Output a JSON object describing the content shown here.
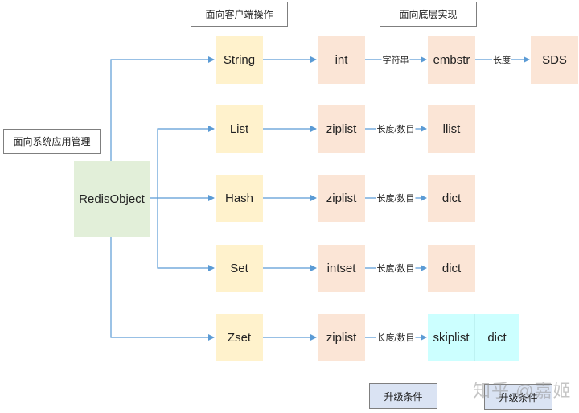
{
  "headers": {
    "client": "面向客户端操作",
    "underlying": "面向底层实现",
    "system": "面向系统应用管理"
  },
  "root": {
    "label": "RedisObject",
    "color": "#e2efd9"
  },
  "colors": {
    "type_fill": "#fff2cc",
    "encoding_fill": "#fbe5d6",
    "zset_final_fill": "#ccffff",
    "upgrade_fill": "#dae3f3",
    "arrow": "#5b9bd5"
  },
  "rows": [
    {
      "type": "String",
      "enc1": "int",
      "cond1": "字符串",
      "enc2": "embstr",
      "cond2": "长度",
      "enc3": "SDS"
    },
    {
      "type": "List",
      "enc1": "ziplist",
      "cond1": "长度/数目",
      "enc2": "llist"
    },
    {
      "type": "Hash",
      "enc1": "ziplist",
      "cond1": "长度/数目",
      "enc2": "dict"
    },
    {
      "type": "Set",
      "enc1": "intset",
      "cond1": "长度/数目",
      "enc2": "dict"
    },
    {
      "type": "Zset",
      "enc1": "ziplist",
      "cond1": "长度/数目",
      "enc2a": "skiplist",
      "enc2b": "dict"
    }
  ],
  "legend": {
    "upgrade_label_1": "升级条件",
    "upgrade_label_2": "升级条件"
  },
  "watermark": "知乎 @嘉姬"
}
